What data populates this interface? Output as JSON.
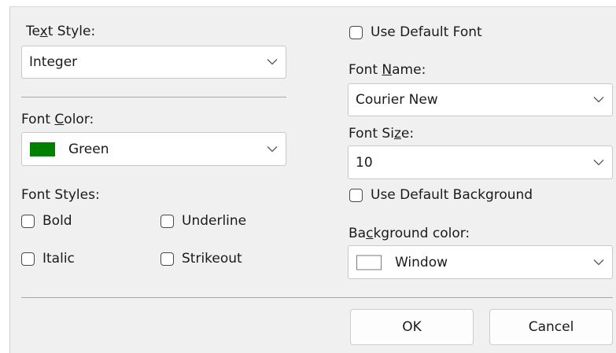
{
  "text_style": {
    "label_prefix": "Te",
    "label_mnemonic": "x",
    "label_suffix": "t Style:",
    "value": "Integer"
  },
  "font_color": {
    "label_prefix": "Font ",
    "label_mnemonic": "C",
    "label_suffix": "olor:",
    "value": "Green",
    "swatch_color": "#008000"
  },
  "font_styles": {
    "label": "Font Styles:",
    "bold": "Bold",
    "italic": "Italic",
    "underline": "Underline",
    "strikeout": "Strikeout"
  },
  "use_default_font": "Use Default Font",
  "font_name": {
    "label_prefix": "Font ",
    "label_mnemonic": "N",
    "label_suffix": "ame:",
    "value": "Courier New"
  },
  "font_size": {
    "label_prefix": "Font Si",
    "label_mnemonic": "z",
    "label_suffix": "e:",
    "value": "10"
  },
  "use_default_background": "Use Default Background",
  "background_color": {
    "label_prefix": "Ba",
    "label_mnemonic": "c",
    "label_suffix": "kground color:",
    "value": "Window",
    "swatch_color": "#ffffff"
  },
  "buttons": {
    "ok": "OK",
    "cancel": "Cancel"
  }
}
